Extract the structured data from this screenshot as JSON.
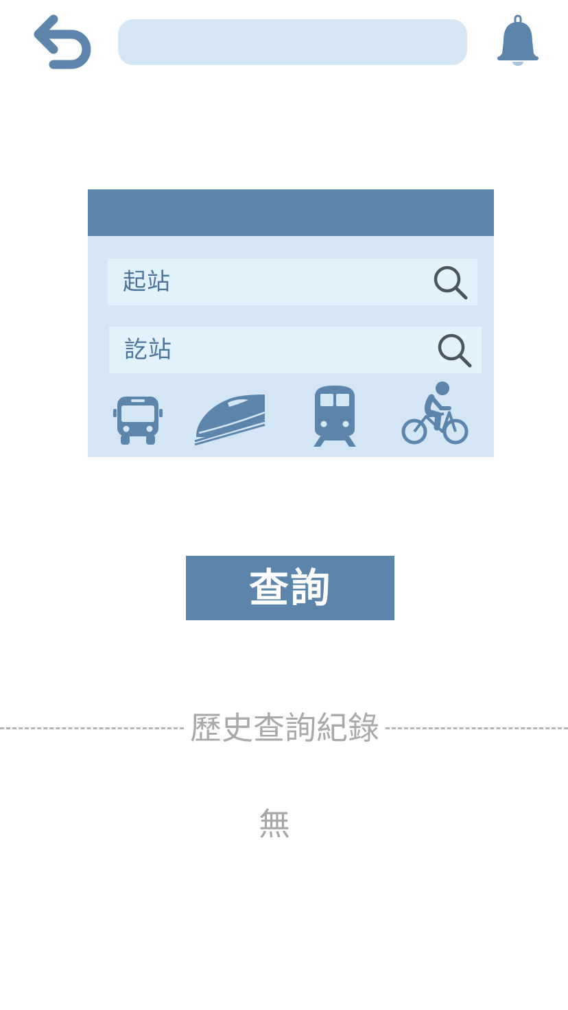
{
  "header": {
    "back_icon": "undo-arrow-icon",
    "search_bar_text": "",
    "notification_icon": "bell-icon"
  },
  "route_form": {
    "origin_label": "起站",
    "destination_label": "訖站",
    "search_icon": "magnifier-icon",
    "transport_modes": [
      {
        "name": "bus",
        "icon": "bus-icon"
      },
      {
        "name": "high-speed-rail",
        "icon": "high-speed-rail-icon"
      },
      {
        "name": "train",
        "icon": "train-icon"
      },
      {
        "name": "bicycle",
        "icon": "bicycle-icon"
      }
    ]
  },
  "query_button": {
    "label": "查詢"
  },
  "history": {
    "title": "歷史查詢紀錄",
    "empty_text": "無"
  },
  "colors": {
    "accent": "#5d84ab",
    "panel": "#d4e6f3",
    "input": "#e2f2fd",
    "muted_text": "#a9a9a9"
  }
}
